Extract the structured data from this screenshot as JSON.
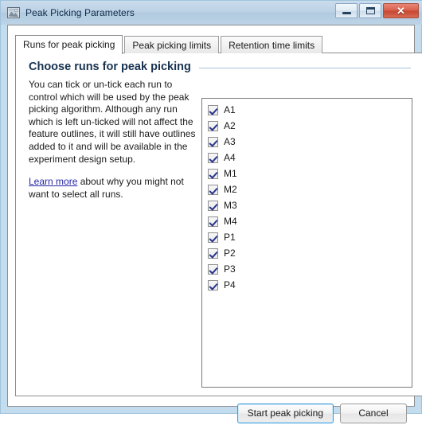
{
  "window": {
    "title": "Peak Picking Parameters",
    "icon": "app-image-icon",
    "controls": {
      "minimize": "minimize-icon",
      "maximize": "maximize-icon",
      "close": "✕"
    },
    "frame_color": "#c3dcee",
    "titlebar_color": "#b6cbe0"
  },
  "tabs": [
    {
      "label": "Runs for peak picking",
      "active": true
    },
    {
      "label": "Peak picking limits",
      "active": false
    },
    {
      "label": "Retention time limits",
      "active": false
    }
  ],
  "panel": {
    "heading": "Choose runs for peak picking",
    "rule_color": "#a9c3e0",
    "paragraph1": "You can tick or un-tick each run to control which will be used by the peak picking algorithm. Although any run which is left un-ticked will not affect the feature outlines, it will still have outlines added to it and will be available in the experiment design setup.",
    "link_text": "Learn more",
    "paragraph2_rest": " about why you might not want to select all runs."
  },
  "runs": [
    {
      "label": "A1",
      "checked": true
    },
    {
      "label": "A2",
      "checked": true
    },
    {
      "label": "A3",
      "checked": true
    },
    {
      "label": "A4",
      "checked": true
    },
    {
      "label": "M1",
      "checked": true
    },
    {
      "label": "M2",
      "checked": true
    },
    {
      "label": "M3",
      "checked": true
    },
    {
      "label": "M4",
      "checked": true
    },
    {
      "label": "P1",
      "checked": true
    },
    {
      "label": "P2",
      "checked": true
    },
    {
      "label": "P3",
      "checked": true
    },
    {
      "label": "P4",
      "checked": true
    }
  ],
  "footer": {
    "primary_label": "Start peak picking",
    "secondary_label": "Cancel",
    "primary_focus_color": "#3c9ddb"
  }
}
